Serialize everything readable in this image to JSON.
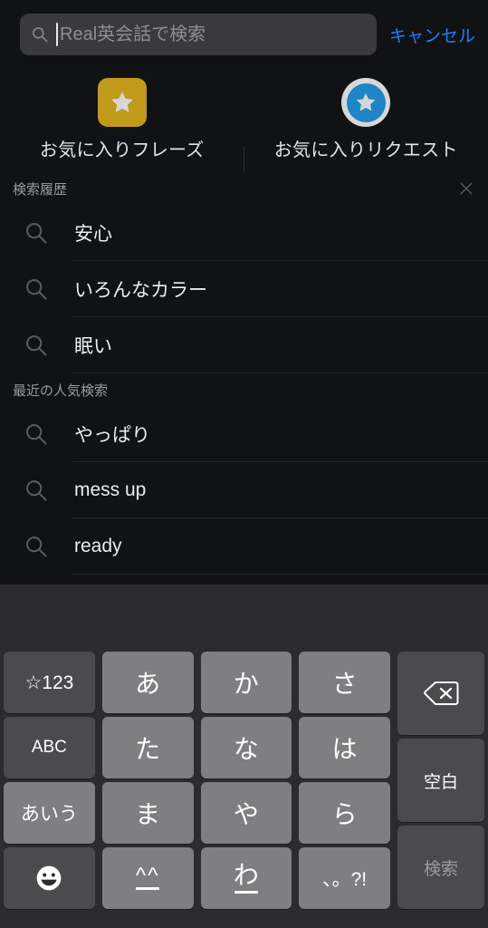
{
  "search": {
    "placeholder": "Real英会話で検索",
    "value": "",
    "cancel_label": "キャンセル",
    "icon": "search-icon",
    "caret_visible": true
  },
  "shortcuts": [
    {
      "label": "お気に入りフレーズ",
      "icon": "star-square-icon",
      "color": "#c19a1b"
    },
    {
      "label": "お気に入りリクエスト",
      "icon": "star-circle-icon",
      "color": "#1e85c6"
    }
  ],
  "sections": [
    {
      "title": "検索履歴",
      "has_clear": true,
      "clear_icon": "close-icon",
      "items": [
        {
          "label": "安心",
          "icon": "search-icon"
        },
        {
          "label": "いろんなカラー",
          "icon": "search-icon"
        },
        {
          "label": "眠い",
          "icon": "search-icon"
        }
      ]
    },
    {
      "title": "最近の人気検索",
      "has_clear": false,
      "items": [
        {
          "label": "やっぱり",
          "icon": "search-icon"
        },
        {
          "label": "mess up",
          "icon": "search-icon"
        },
        {
          "label": "ready",
          "icon": "search-icon"
        }
      ]
    }
  ],
  "keyboard": {
    "type": "japanese-kana-12key",
    "keys": {
      "k_123": "☆123",
      "k_a": "あ",
      "k_ka": "か",
      "k_sa": "さ",
      "k_backspace": "delete-icon",
      "k_abc": "ABC",
      "k_ta": "た",
      "k_na": "な",
      "k_ha": "は",
      "k_space": "空白",
      "k_aiu": "あいう",
      "k_ma": "ま",
      "k_ya": "や",
      "k_ra": "ら",
      "k_search": "検索",
      "k_emoji": "emoji-icon",
      "k_kaomoji": "^^",
      "k_wa": "わ",
      "k_punct": "、。?!"
    }
  },
  "colors": {
    "background": "#111214",
    "accent_blue": "#1a7fff",
    "keyboard_bg": "#2c2c2e",
    "key_bg": "#7f7f81",
    "key_fn_bg": "#4b4b4d",
    "gold": "#c19a1b",
    "blue_badge": "#1e85c6"
  }
}
